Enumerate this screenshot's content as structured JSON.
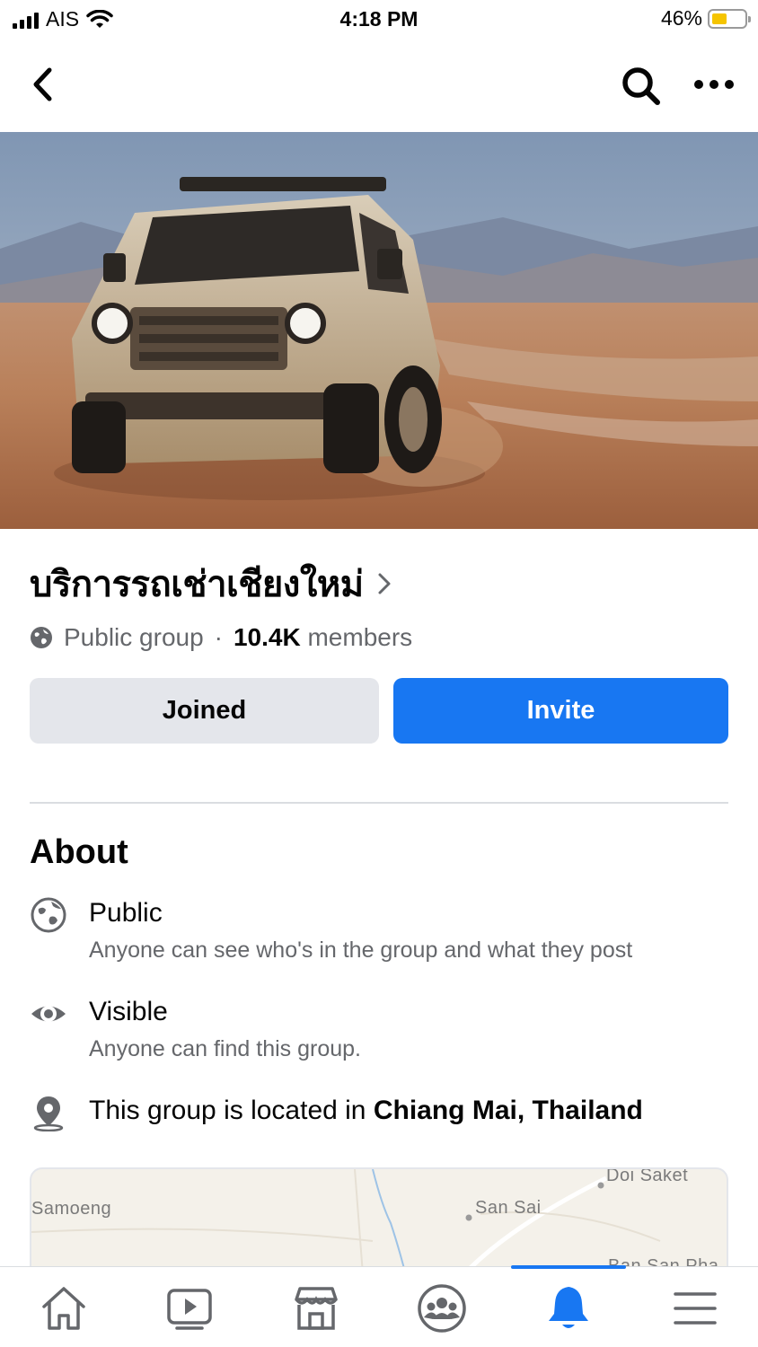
{
  "status_bar": {
    "carrier": "AIS",
    "time": "4:18 PM",
    "battery_percent": "46%",
    "battery_level": 0.46,
    "battery_color": "#f5c400"
  },
  "nav": {
    "back_icon": "chevron-left-icon",
    "search_icon": "search-icon",
    "more_icon": "more-horizontal-icon"
  },
  "group": {
    "name": "บริการรถเช่าเชียงใหม่",
    "privacy": "Public group",
    "separator": "·",
    "members_count": "10.4K",
    "members_label": "members"
  },
  "actions": {
    "joined_label": "Joined",
    "invite_label": "Invite",
    "invite_color": "#1877f2"
  },
  "about": {
    "title": "About",
    "public_title": "Public",
    "public_desc": "Anyone can see who's in the group and what they post",
    "visible_title": "Visible",
    "visible_desc": "Anyone can find this group.",
    "location_prefix": "This group is located in",
    "location": "Chiang Mai, Thailand"
  },
  "map": {
    "labels": [
      "Samoeng",
      "San Sai",
      "Doi Saket",
      "Ban San Pha"
    ]
  },
  "tabbar": {
    "items": [
      "home-icon",
      "video-icon",
      "marketplace-icon",
      "groups-icon",
      "notifications-icon",
      "menu-icon"
    ],
    "active": "notifications-icon",
    "active_color": "#1877f2"
  }
}
